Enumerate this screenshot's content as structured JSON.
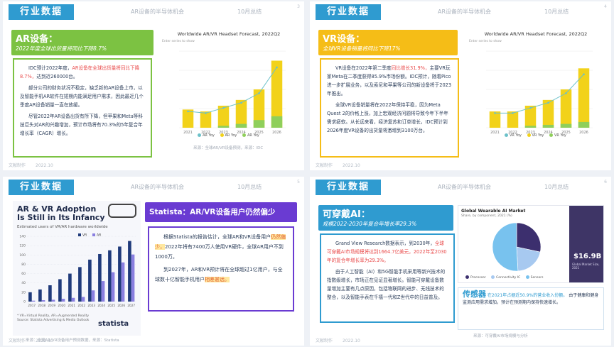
{
  "common": {
    "tag": "行业数据",
    "author": "文献制作",
    "date": "2022.10",
    "month": "10月总结"
  },
  "s1": {
    "page": "3",
    "header": "AR设备的半导体机会",
    "title": "AR设备：",
    "subtitle": "2022年度全球出货量将同比下降8.7%",
    "p1a": "IDC预计2022年度，",
    "p1b": "AR设备在全球出货量将同比下降8.7%，",
    "p1c": "达到近260000台。",
    "p2": "部分公司的财务状况不稳定，缺乏新的AR设备上市，以及智能手机AR软件在短期内能满足用户需求，因此最近几个季度AR设备销量一直在放缓。",
    "p3": "尽管2022年AR设备出货有所下降，但苹果和Meta等科技巨头对AR的兴趣增加，预计市场将有70.3%的5年复合年增长率（CAGR）增长。",
    "colors": {
      "banner": "#7cc242",
      "border": "#7cc242",
      "bar": "#f2d21a",
      "line": "#6cc1c9",
      "bar2": "#8fcf5b"
    },
    "chart_data": {
      "type": "bar",
      "title": "Worldwide AR/VR Headset Forecast, 2022Q2",
      "note": "Enter series to show",
      "categories": [
        "2021",
        "2022",
        "2023",
        "2024",
        "2025",
        "2026"
      ],
      "series": [
        {
          "name": "AR Yoy",
          "values": [
            9.5,
            8.5,
            11.5,
            14.5,
            20,
            35
          ]
        },
        {
          "name": "AR Yoy",
          "values": [
            0,
            0,
            1,
            2,
            4,
            6
          ]
        }
      ],
      "legend": [
        "AR Yoy",
        "AR Yoy",
        "AR Yoy"
      ],
      "source": "来源：全球AR/VR设备预测，来源：IDC"
    }
  },
  "s2": {
    "page": "4",
    "header": "AR设备的半导体机会",
    "title": "VR设备：",
    "subtitle": "全球VR设备销量将同比下降17%",
    "p1a": "VR设备在2022年第二季度",
    "p1b": "同比增长31.9%，",
    "p1c": "主要VR玩家Meta在二季度获得85.9%市场份额。IDC预计，随着Pico进一步扩展业务，以及索尼和苹果等公司的新设备将于2023年推出。",
    "p2": "全球VR设备销量将在2022年保持平稳，因为Meta Quest 2的价格上涨，加上宏观经济问题将导致今年下半年需求疲软。从长远来看，经济复苏和订单增长，IDC预计到2026年度VR设备的出货量将激增到3100万台。",
    "colors": {
      "banner": "#f5bd17",
      "border": "#f5bd17",
      "bar": "#f2d21a",
      "line": "#6cc1c9",
      "bar2": "#8fcf5b"
    },
    "chart_data": {
      "type": "bar",
      "title": "Worldwide AR/VR Headset Forecast, 2022Q2",
      "note": "Enter series to show",
      "categories": [
        "2021",
        "2022",
        "2023",
        "2024",
        "2025",
        "2026"
      ],
      "series": [
        {
          "name": "VR Yoy",
          "values": [
            8.5,
            8.5,
            11.5,
            14.5,
            20,
            31
          ]
        },
        {
          "name": "VR Yoy",
          "values": [
            0,
            0,
            1,
            1.5,
            2,
            3
          ]
        }
      ],
      "legend": [
        "VR Yoy",
        "VR Yoy",
        "VR Yoy"
      ],
      "source": "来源：全球AR/VR设备预测，来源：IDC"
    }
  },
  "s3": {
    "page": "5",
    "header": "AR设备的半导体机会",
    "infotitle1": "AR & VR Adoption",
    "infotitle2": "Is Still in Its Infancy",
    "infosub": "Estimated users of VR/AR hardware worldwide",
    "footnote1": "* VR=Virtual Reality, AR=Augmented Reality",
    "footnote2": "Source: Statista Advertising & Media Outlook",
    "brand": "statista",
    "source": "来源：全球AR/VR设备用户预测数据，来源：Statista",
    "banner_title": "Statista：AR/VR设备用户仍然偏少",
    "p1a": "根据Statista的报告估计，全球AR和VR设备用户",
    "p1b": "仍然偏少，",
    "p1c": "2022年将有7400万人使用VR硬件，全球AR用户不到1000万。",
    "p2a": "到2027年，AR和VR预计将在全球超过1亿用户，与全球数十亿智能手机用户",
    "p2b": "相差甚远。",
    "colors": {
      "banner": "#6a3bd2",
      "border": "#6a3bd2",
      "vr": "#1f3a7a",
      "ar": "#8a7fe0"
    },
    "chart_data": {
      "type": "bar",
      "categories": [
        "2017",
        "2018",
        "2019",
        "2020",
        "2021",
        "2022",
        "2023",
        "2024",
        "2025",
        "2026",
        "2027"
      ],
      "series": [
        {
          "name": "VR",
          "values": [
            20,
            26,
            35,
            48,
            60,
            74,
            90,
            102,
            110,
            118,
            130
          ]
        },
        {
          "name": "AR",
          "values": [
            2,
            3,
            4,
            6,
            8,
            10,
            24,
            44,
            63,
            84,
            101
          ]
        }
      ],
      "yticks": [
        "0",
        "20",
        "40",
        "60",
        "80",
        "100",
        "120",
        "140"
      ],
      "ylim": [
        0,
        140
      ]
    }
  },
  "s4": {
    "page": "6",
    "header": "AR设备的半导体机会",
    "title": "可穿戴AI：",
    "subtitle": "规模2022-2030年复合年增长率29.3%",
    "p1a": "Grand View Research数据表示，到2030年，",
    "p1b": "全球可穿戴AI市场规模将达到1664.7亿美元，2022年至2030年的复合年增长率为29.3%。",
    "p2": "由于人工智能（AI）和5G智能手机采用等新兴技术的指数级增长，市场正在见证显著增长。智能可穿戴设备数量增加主要有几点原因，包括物联网的进步、无线技术的整合，以及智能手表在千禧一代和Z世代中的日益普及。",
    "sensor_title": "传感器",
    "sensor_hl": "在2021年占据近50.9%的营业收入份额。",
    "sensor_text": "由于健康和健身监测应用需求增加，预计在预测期内保持快速增长。",
    "market_title": "Global Wearable AI Market",
    "market_sub": "Share, by component, 2021 (%)",
    "value_label": "Global Market Size, 2021",
    "value": "$16.9B",
    "legend_items": [
      "Processor",
      "Connectivity IC",
      "Sensors"
    ],
    "source": "来源：可穿戴AI市场规模与分析",
    "colors": {
      "banner": "#2f9bd0",
      "border": "#2f9bd0",
      "side": "#3e3566",
      "sensor": "#2f9bd0"
    },
    "chart_data": {
      "type": "pie",
      "categories": [
        "Processor",
        "Connectivity IC",
        "Sensors"
      ],
      "values": [
        28.4,
        20.7,
        50.9
      ],
      "colors": [
        "#3c2f6e",
        "#a7c9f0",
        "#78c2ee"
      ]
    }
  }
}
